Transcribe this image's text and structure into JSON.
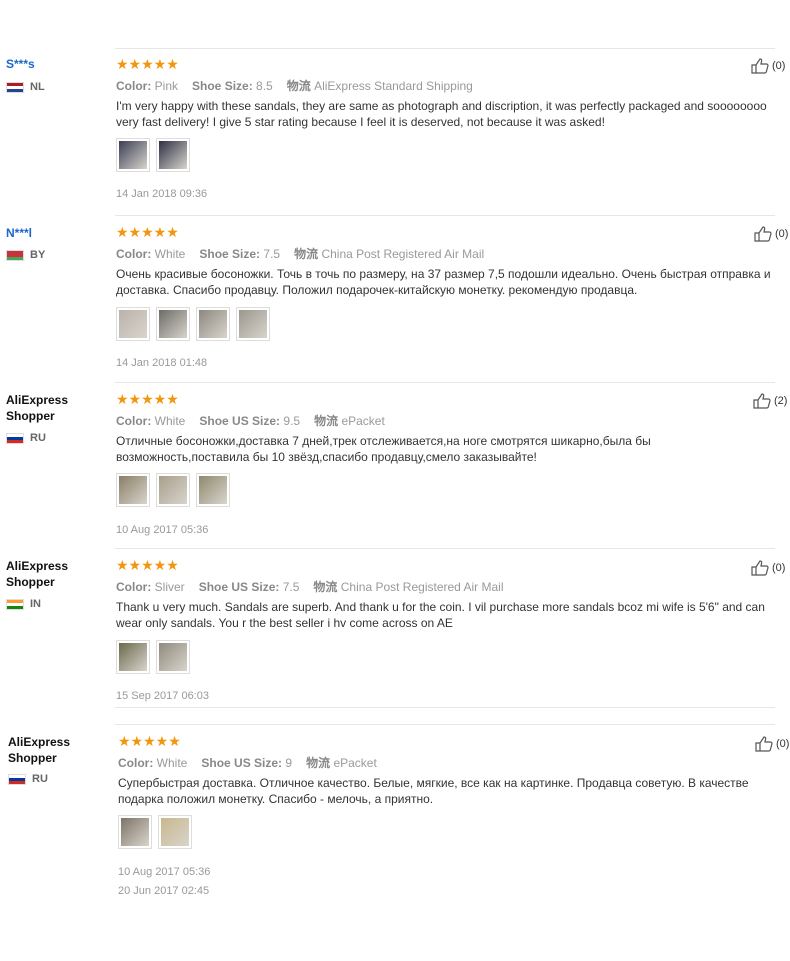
{
  "reviews": [
    {
      "user": "S***s",
      "country": "NL",
      "flag_colors": [
        "#ae1c28",
        "#ffffff",
        "#21468b"
      ],
      "stars": "★★★★★",
      "color_label": "Color:",
      "color": "Pink",
      "size_label": "Shoe Size:",
      "size": "8.5",
      "shipping_label": "物流",
      "shipping": "AliExpress Standard Shipping",
      "text": "I'm very happy with these sandals, they are same as photograph and discription, it was perfectly packaged and soooooooo very fast delivery! I give 5 star rating because I feel it is deserved, not because it was asked!",
      "photo_colors": [
        "#3a3e55",
        "#2d2f45"
      ],
      "date": "14 Jan 2018 09:36",
      "helpful": "(0)"
    },
    {
      "user": "N***l",
      "country": "BY",
      "flag_colors": [
        "#c8313e",
        "#c8313e",
        "#4aa657"
      ],
      "stars": "★★★★★",
      "color_label": "Color:",
      "color": "White",
      "size_label": "Shoe Size:",
      "size": "7.5",
      "shipping_label": "物流",
      "shipping": "China Post Registered Air Mail",
      "text": "Очень красивые босоножки. Точь в точь по размеру, на 37 размер 7,5 подошли идеально. Очень быстрая отправка и доставка. Спасибо продавцу. Положил подарочек-китайскую монетку. рекомендую продавца.",
      "photo_colors": [
        "#b9b2aa",
        "#6c6c66",
        "#8d877f",
        "#9a978e"
      ],
      "date": "14 Jan 2018 01:48",
      "helpful": "(0)"
    },
    {
      "user": "AliExpress Shopper",
      "country": "RU",
      "flag_colors": [
        "#ffffff",
        "#0039a6",
        "#d52b1e"
      ],
      "stars": "★★★★★",
      "color_label": "Color:",
      "color": "White",
      "size_label": "Shoe US Size:",
      "size": "9.5",
      "shipping_label": "物流",
      "shipping": "ePacket",
      "text": "Отличные босоножки,доставка 7 дней,трек отслеживается,на ноге смотрятся шикарно,была бы возможность,поставила бы 10 звёзд,спасибо продавцу,смело заказывайте!",
      "photo_colors": [
        "#8a7f66",
        "#a89e8c",
        "#8e8a6e"
      ],
      "date": "10 Aug 2017 05:36",
      "helpful": "(2)"
    },
    {
      "user": "AliExpress Shopper",
      "country": "IN",
      "flag_colors": [
        "#ff9933",
        "#ffffff",
        "#138808"
      ],
      "stars": "★★★★★",
      "color_label": "Color:",
      "color": "Sliver",
      "size_label": "Shoe US Size:",
      "size": "7.5",
      "shipping_label": "物流",
      "shipping": "China Post Registered Air Mail",
      "text": "Thank u very much. Sandals are superb. And thank u for the coin. I vil purchase more sandals bcoz mi wife is 5'6\" and can wear only sandals. You r the best seller i hv come across on AE",
      "photo_colors": [
        "#6b6a4c",
        "#8e8a7c"
      ],
      "date": "15 Sep 2017 06:03",
      "helpful": "(0)"
    },
    {
      "user": "AliExpress Shopper",
      "country": "RU",
      "flag_colors": [
        "#ffffff",
        "#0039a6",
        "#d52b1e"
      ],
      "stars": "★★★★★",
      "color_label": "Color:",
      "color": "White",
      "size_label": "Shoe US Size:",
      "size": "9",
      "shipping_label": "物流",
      "shipping": "ePacket",
      "text": "Супербыстрая доставка. Отличное качество. Белые, мягкие, все как на картинке. Продавца советую. В качестве подарка положил монетку. Спасибо - мелочь, а приятно.",
      "photo_colors": [
        "#7e7466",
        "#c9b78d"
      ],
      "date": "10 Aug 2017 05:36",
      "date2": "20 Jun 2017 02:45",
      "helpful": "(0)"
    }
  ]
}
